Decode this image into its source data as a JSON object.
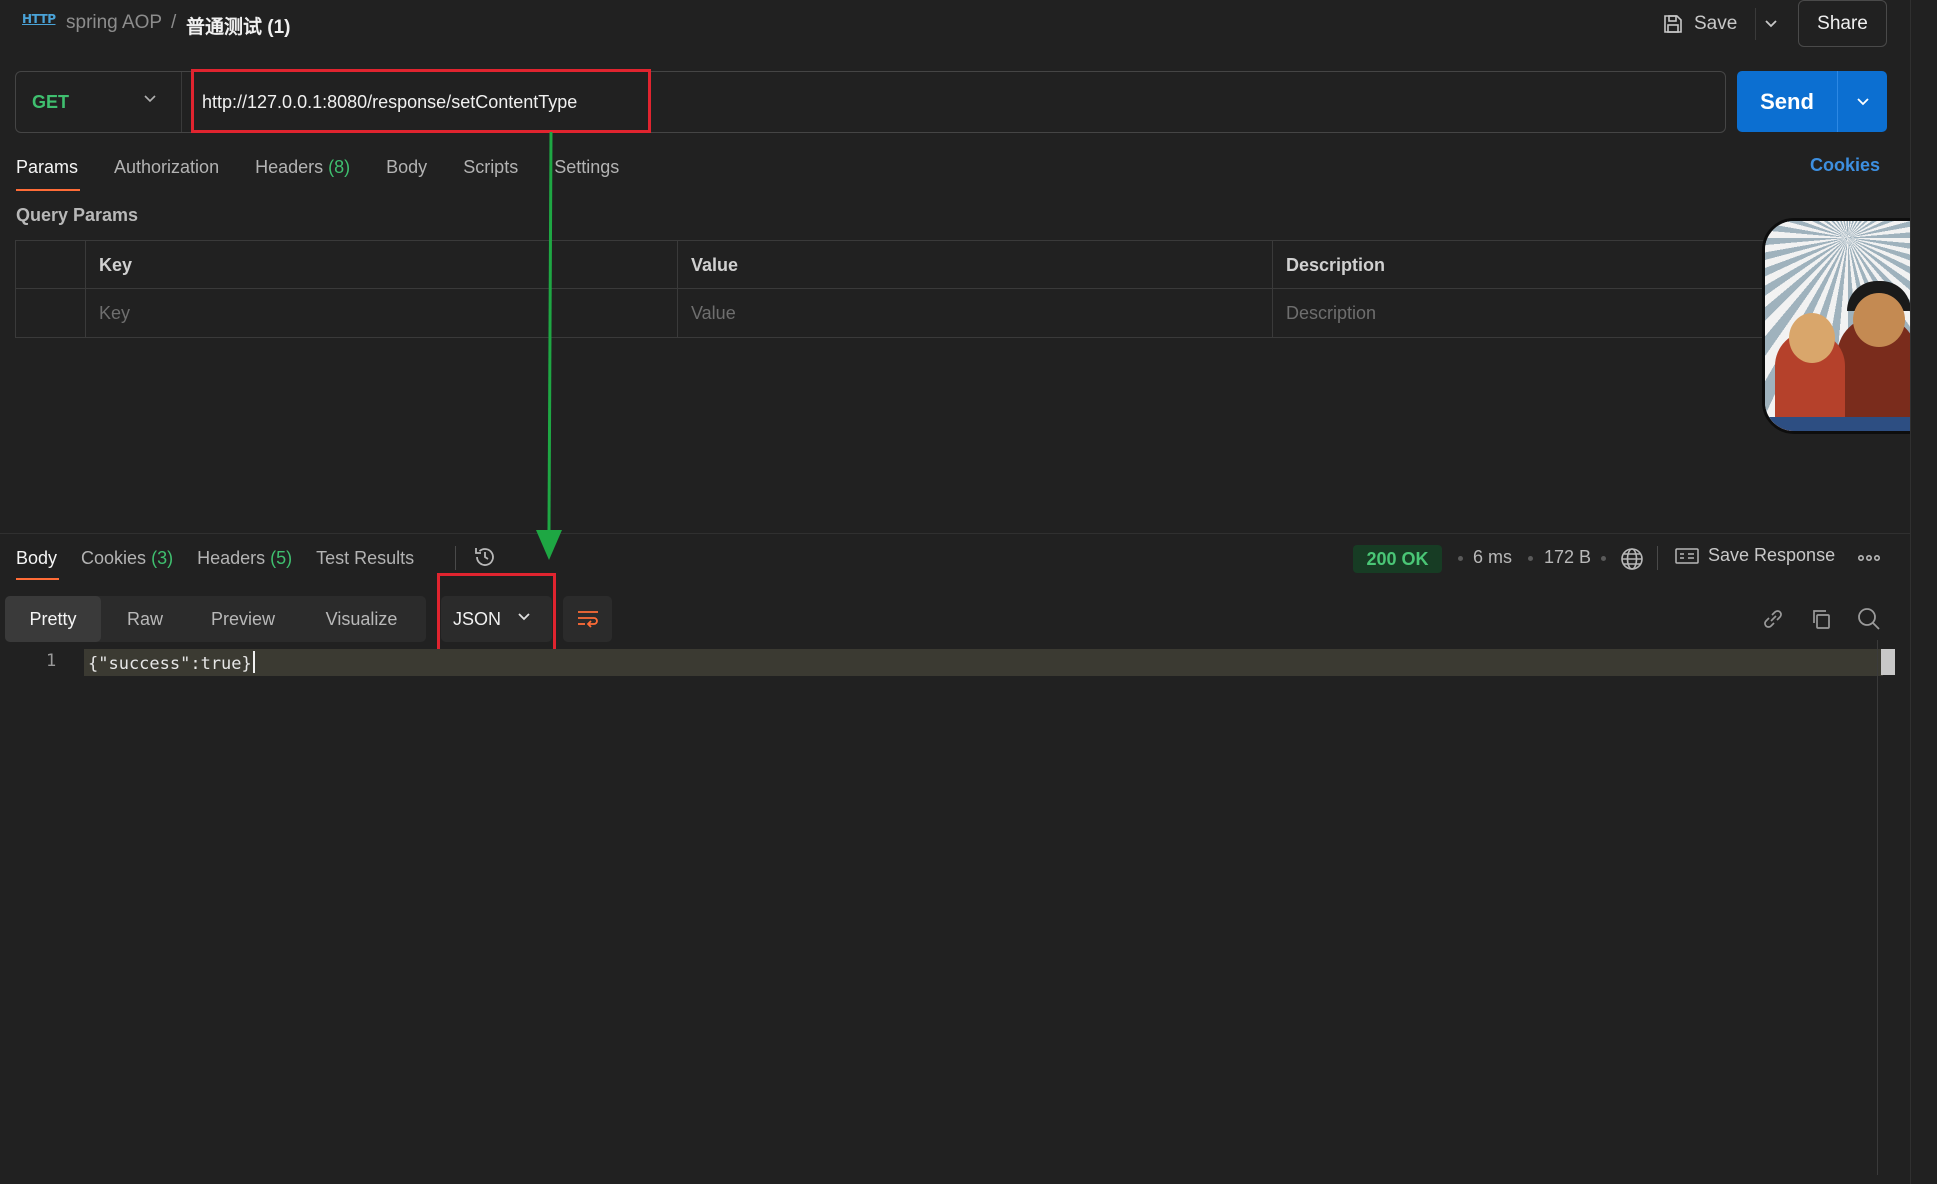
{
  "header": {
    "breadcrumb_parent": "spring AOP",
    "breadcrumb_sep": "/",
    "breadcrumb_current": "普通测试 (1)",
    "save_label": "Save",
    "share_label": "Share"
  },
  "request": {
    "method": "GET",
    "url": "http://127.0.0.1:8080/response/setContentType",
    "send_label": "Send",
    "tabs": [
      {
        "label": "Params",
        "count": ""
      },
      {
        "label": "Authorization",
        "count": ""
      },
      {
        "label": "Headers",
        "count": "(8)"
      },
      {
        "label": "Body",
        "count": ""
      },
      {
        "label": "Scripts",
        "count": ""
      },
      {
        "label": "Settings",
        "count": ""
      }
    ],
    "cookies_link": "Cookies"
  },
  "params": {
    "title": "Query Params",
    "headers": [
      "Key",
      "Value",
      "Description"
    ],
    "placeholders": [
      "Key",
      "Value",
      "Description"
    ]
  },
  "response": {
    "tabs": [
      {
        "label": "Body",
        "count": ""
      },
      {
        "label": "Cookies",
        "count": "(3)"
      },
      {
        "label": "Headers",
        "count": "(5)"
      },
      {
        "label": "Test Results",
        "count": ""
      }
    ],
    "status": "200 OK",
    "time": "6 ms",
    "size": "172 B",
    "save_response": "Save Response",
    "views": [
      "Pretty",
      "Raw",
      "Preview",
      "Visualize"
    ],
    "format": "JSON",
    "line_number": "1",
    "code_line": "{\"success\":true}"
  },
  "colors": {
    "accent_orange": "#ff6c37",
    "send_blue": "#0c6fd1",
    "method_green": "#3fbf6f",
    "annotation_red": "#e0242f",
    "annotation_arrow": "#1ea743"
  },
  "icons": [
    "http-icon",
    "save-icon",
    "chevron-down-icon",
    "history-icon",
    "globe-icon",
    "save-response-icon",
    "more-icon",
    "wrap-lines-icon",
    "link-icon",
    "copy-icon",
    "search-icon"
  ]
}
